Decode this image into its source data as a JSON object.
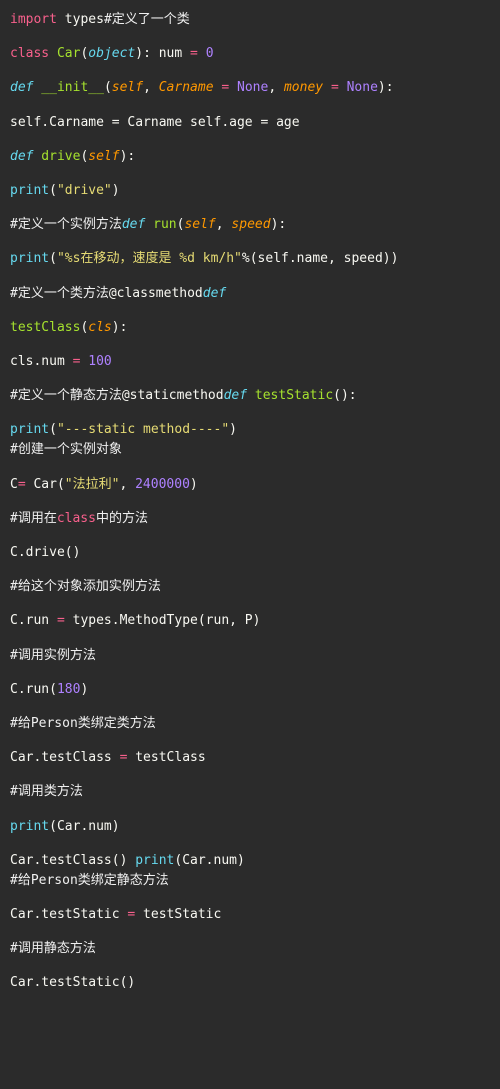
{
  "lines": {
    "l1_import": "import",
    "l1_types": " types",
    "l1_cmt": "#定义了一个类",
    "l2_class": "class",
    "l2_name": " Car",
    "l2_obj": "object",
    "l2_num": " num ",
    "l2_eq": "=",
    "l2_zero": " 0",
    "l3_def": "def",
    "l3_init": " __init__",
    "l3_self": "self",
    "l3_p1": "Carname",
    "l3_none1": "None",
    "l3_p2": "money",
    "l3_none2": "None",
    "l4": "self.Carname = Carname self.age = age",
    "l5_def": "def",
    "l5_drive": " drive",
    "l5_self": "self",
    "l6_print": "print",
    "l6_str": "\"drive\"",
    "l7_cmt": "#定义一个实例方法",
    "l7_def": "def",
    "l7_run": " run",
    "l7_self": "self",
    "l7_speed": "speed",
    "l8_print": "print",
    "l8_str": "\"%s在移动，速度是 %d km/h\"",
    "l8_rest": "%(self.name, speed))",
    "l9_cmt": "#定义一个类方法",
    "l9_deco": "@classmethod",
    "l9_def": "def",
    "l10_tc": "testClass",
    "l10_cls": "cls",
    "l11a": "cls.num ",
    "l11eq": "=",
    "l11num": " 100",
    "l12_cmt": "#定义一个静态方法",
    "l12_deco": "@staticmethod",
    "l12_def": "def",
    "l12_ts": " testStatic",
    "l13_print": "print",
    "l13_str": "\"---static method----\"",
    "l14_cmt": "#创建一个实例对象",
    "l15a": "C",
    "l15eq": "=",
    "l15car": " Car(",
    "l15str": "\"法拉利\"",
    "l15num": "2400000",
    "l16a_cmt": "#调用在",
    "l16a_cls": "class",
    "l16a_cmt2": "中的方法",
    "l17": "C.drive()",
    "l18_cmt": "#给这个对象添加实例方法",
    "l19a": "C.run ",
    "l19eq": "=",
    "l19b": " types.MethodType(run, P)",
    "l20_cmt": "#调用实例方法",
    "l21a": "C.run(",
    "l21num": "180",
    "l22_cmt": "#给Person类绑定类方法",
    "l23a": "Car.testClass ",
    "l23eq": "=",
    "l23b": " testClass",
    "l24_cmt": "#调用类方法",
    "l25_print": "print",
    "l25_rest": "(Car.num)",
    "l26a": "Car.testClass() ",
    "l26_print": "print",
    "l26_rest": "(Car.num)",
    "l27_cmt": "#给Person类绑定静态方法",
    "l28a": "Car.testStatic ",
    "l28eq": "=",
    "l28b": " testStatic",
    "l29_cmt": "#调用静态方法",
    "l30": "Car.testStatic()"
  }
}
